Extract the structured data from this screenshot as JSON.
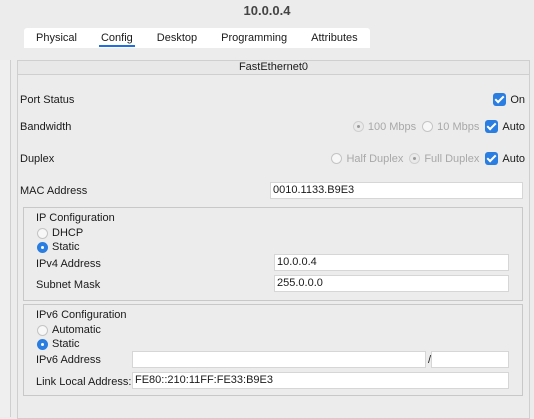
{
  "window": {
    "title": "10.0.0.4"
  },
  "tabs": [
    {
      "label": "Physical",
      "active": false
    },
    {
      "label": "Config",
      "active": true
    },
    {
      "label": "Desktop",
      "active": false
    },
    {
      "label": "Programming",
      "active": false
    },
    {
      "label": "Attributes",
      "active": false
    }
  ],
  "interface": {
    "name": "FastEthernet0",
    "port_status": {
      "label": "Port Status",
      "on_label": "On",
      "on": true
    },
    "bandwidth": {
      "label": "Bandwidth",
      "options": [
        "100 Mbps",
        "10 Mbps"
      ],
      "selected": "100 Mbps",
      "auto_label": "Auto",
      "auto": true
    },
    "duplex": {
      "label": "Duplex",
      "options": [
        "Half Duplex",
        "Full Duplex"
      ],
      "selected": "Full Duplex",
      "auto_label": "Auto",
      "auto": true
    },
    "mac": {
      "label": "MAC Address",
      "value": "0010.1133.B9E3"
    }
  },
  "ipv4": {
    "title": "IP Configuration",
    "dhcp_label": "DHCP",
    "static_label": "Static",
    "mode": "Static",
    "address_label": "IPv4 Address",
    "address": "10.0.0.4",
    "mask_label": "Subnet Mask",
    "mask": "255.0.0.0"
  },
  "ipv6": {
    "title": "IPv6 Configuration",
    "automatic_label": "Automatic",
    "static_label": "Static",
    "mode": "Static",
    "address_label": "IPv6 Address",
    "address": "",
    "prefix_sep": "/",
    "prefix": "",
    "link_local_label": "Link Local Address:",
    "link_local": "FE80::210:11FF:FE33:B9E3"
  },
  "colors": {
    "accent": "#2a7de1",
    "background": "#ececec"
  }
}
